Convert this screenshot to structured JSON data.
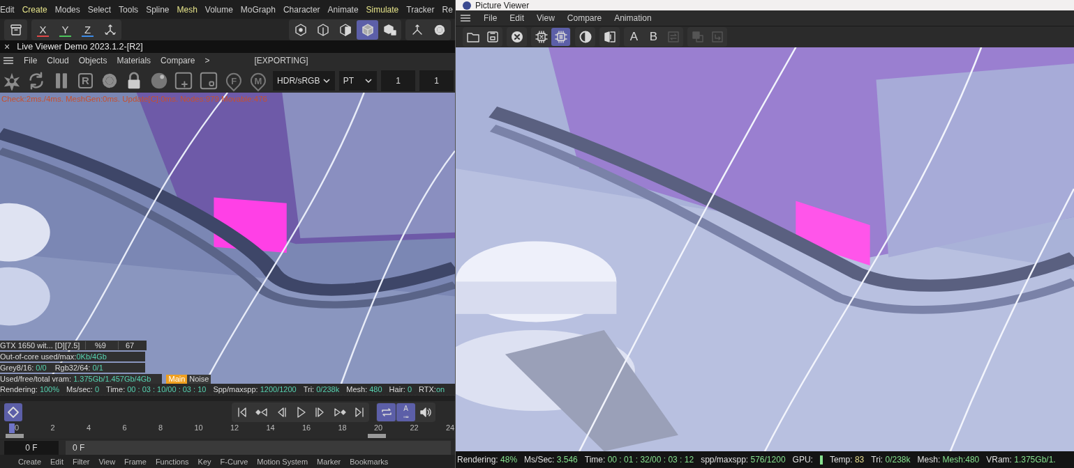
{
  "app_menu": {
    "items": [
      {
        "label": "Edit",
        "highlighted": false
      },
      {
        "label": "Create",
        "highlighted": true
      },
      {
        "label": "Modes",
        "highlighted": false
      },
      {
        "label": "Select",
        "highlighted": false
      },
      {
        "label": "Tools",
        "highlighted": false
      },
      {
        "label": "Spline",
        "highlighted": false
      },
      {
        "label": "Mesh",
        "highlighted": true
      },
      {
        "label": "Volume",
        "highlighted": false
      },
      {
        "label": "MoGraph",
        "highlighted": false
      },
      {
        "label": "Character",
        "highlighted": false
      },
      {
        "label": "Animate",
        "highlighted": false
      },
      {
        "label": "Simulate",
        "highlighted": true
      },
      {
        "label": "Tracker",
        "highlighted": false
      },
      {
        "label": "Re",
        "highlighted": false
      }
    ]
  },
  "main_toolbar": {
    "left_groups": [
      {
        "items": [
          {
            "kind": "archive",
            "selected": false
          }
        ]
      },
      {
        "items": [
          {
            "kind": "letter",
            "label": "X",
            "color": "#e04848",
            "selected": false
          },
          {
            "kind": "letter",
            "label": "Y",
            "color": "#4cc45c",
            "selected": false
          },
          {
            "kind": "letter",
            "label": "Z",
            "color": "#3c8ce8",
            "selected": false
          },
          {
            "kind": "gizmo",
            "selected": false
          }
        ]
      }
    ],
    "right_groups": [
      {
        "items": [
          {
            "kind": "hex-dot",
            "selected": false
          },
          {
            "kind": "hex-edge",
            "selected": false
          },
          {
            "kind": "cube-half",
            "selected": false
          },
          {
            "kind": "cube",
            "selected": true
          },
          {
            "kind": "cubes",
            "selected": false
          }
        ]
      },
      {
        "items": [
          {
            "kind": "axes",
            "selected": false
          },
          {
            "kind": "gear",
            "selected": false
          }
        ]
      }
    ]
  },
  "live_viewer": {
    "title": "Live Viewer Demo 2023.1.2-[R2]",
    "close": "×",
    "menu": [
      {
        "label": "File"
      },
      {
        "label": "Cloud"
      },
      {
        "label": "Objects"
      },
      {
        "label": "Materials"
      },
      {
        "label": "Compare"
      },
      {
        "label": ">"
      }
    ],
    "status_text": "[EXPORTING]",
    "tools": [
      {
        "kind": "aperture"
      },
      {
        "kind": "refresh"
      },
      {
        "kind": "pause"
      },
      {
        "kind": "boxed-letter",
        "label": "R"
      },
      {
        "kind": "gear"
      },
      {
        "kind": "lock"
      },
      {
        "kind": "sphere"
      },
      {
        "kind": "add-region"
      },
      {
        "kind": "region"
      },
      {
        "kind": "pin-letter",
        "label": "F"
      },
      {
        "kind": "pin-letter",
        "label": "M"
      }
    ],
    "dropdowns": [
      {
        "value": "HDR/sRGB"
      },
      {
        "value": "PT"
      }
    ],
    "fields": [
      {
        "value": "1"
      },
      {
        "value": "1"
      }
    ],
    "viewport": {
      "kind": "picture",
      "debug_text": "Check:2ms./4ms. MeshGen:0ms. Update[C]:0ms. Nodes:979 Movable:476",
      "gpu_row": {
        "cells": [
          "GTX 1650 wit... [D][7.5]",
          "%9",
          "67"
        ]
      },
      "stat_rows": [
        {
          "items": [
            {
              "label": "Out-of-core used/max:",
              "value": "0Kb/4Gb"
            }
          ]
        },
        {
          "items": [
            {
              "label": "Grey8/16: ",
              "value": "0/0"
            },
            {
              "label": "Rgb32/64: ",
              "value": "0/1"
            }
          ]
        },
        {
          "items": [
            {
              "label": "Used/free/total vram: ",
              "value": "1.375Gb/1.457Gb/4Gb"
            }
          ]
        }
      ],
      "tabs": [
        {
          "label": "Main",
          "selected": true
        },
        {
          "label": "Noise",
          "selected": false
        }
      ]
    },
    "status_bar": [
      {
        "label": "Rendering: ",
        "value": "100%"
      },
      {
        "label": "Ms/sec: ",
        "value": "0"
      },
      {
        "label": "Time: ",
        "value": "00 : 03 : 10/00 : 03 : 10"
      },
      {
        "label": "Spp/maxspp: ",
        "value": "1200/1200"
      },
      {
        "label": "Tri: ",
        "value": "0/238k"
      },
      {
        "label": "Mesh: ",
        "value": "480"
      },
      {
        "label": "Hair: ",
        "value": "0"
      },
      {
        "label": "RTX:",
        "value": "on"
      }
    ]
  },
  "timeline": {
    "key_button": {
      "kind": "key",
      "selected": true
    },
    "transport": [
      {
        "kind": "first"
      },
      {
        "kind": "prev-key"
      },
      {
        "kind": "prev-frame"
      },
      {
        "kind": "play"
      },
      {
        "kind": "next-frame"
      },
      {
        "kind": "next-key"
      },
      {
        "kind": "last"
      }
    ],
    "toggles": [
      {
        "kind": "loop",
        "selected": true
      },
      {
        "kind": "auto-key",
        "label": "A",
        "selected": true
      },
      {
        "kind": "sound",
        "selected": false
      }
    ],
    "ruler": [
      "0",
      "2",
      "4",
      "6",
      "8",
      "10",
      "12",
      "14",
      "16",
      "18",
      "20",
      "22",
      "24"
    ],
    "playhead": {
      "level": 0
    },
    "frame_field": "0 F",
    "frame_bar": "0 F"
  },
  "bottom_menu": [
    "Create",
    "Edit",
    "Filter",
    "View",
    "Frame",
    "Functions",
    "Key",
    "F-Curve",
    "Motion System",
    "Marker",
    "Bookmarks"
  ],
  "picture_viewer": {
    "title": "Picture Viewer",
    "menu": [
      {
        "label": "File"
      },
      {
        "label": "Edit"
      },
      {
        "label": "View"
      },
      {
        "label": "Compare"
      },
      {
        "label": "Animation"
      }
    ],
    "toolbar": [
      {
        "items": [
          {
            "kind": "folder",
            "selected": false,
            "disabled": false
          },
          {
            "kind": "save",
            "selected": false,
            "disabled": false
          }
        ]
      },
      {
        "items": [
          {
            "kind": "close-circle",
            "selected": false,
            "disabled": false
          }
        ]
      },
      {
        "items": [
          {
            "kind": "chip-x",
            "selected": false,
            "disabled": false
          },
          {
            "kind": "chip",
            "selected": true,
            "disabled": false
          }
        ]
      },
      {
        "items": [
          {
            "kind": "contrast",
            "selected": false,
            "disabled": false
          }
        ]
      },
      {
        "items": [
          {
            "kind": "split",
            "selected": false,
            "disabled": false
          }
        ]
      },
      {
        "items": [
          {
            "kind": "letter",
            "label": "A",
            "selected": false,
            "disabled": false
          },
          {
            "kind": "letter",
            "label": "B",
            "selected": false,
            "disabled": false
          },
          {
            "kind": "swap",
            "selected": false,
            "disabled": true
          }
        ]
      },
      {
        "items": [
          {
            "kind": "layers",
            "selected": false,
            "disabled": true
          },
          {
            "kind": "export",
            "selected": false,
            "disabled": true
          }
        ]
      }
    ],
    "status_bar": [
      {
        "kind": "text",
        "label": "Rendering: ",
        "value": "48%",
        "color": "#86e08e"
      },
      {
        "kind": "text",
        "label": "Ms/Sec: ",
        "value": "3.546",
        "color": "#86e08e"
      },
      {
        "kind": "text",
        "label": "Time: ",
        "value": "00 : 01 : 32/00 : 03 : 12",
        "color": "#86e08e"
      },
      {
        "kind": "text",
        "label": "spp/maxspp: ",
        "value": "576/1200",
        "color": "#86e08e"
      },
      {
        "kind": "meter",
        "label": "GPU: ",
        "color": "#86e08e"
      },
      {
        "kind": "text",
        "label": "Temp: ",
        "value": "83",
        "color": "#e6dc8e"
      },
      {
        "kind": "text",
        "label": "Tri: ",
        "value": "0/238k",
        "color": "#86e08e"
      },
      {
        "kind": "text",
        "label": "Mesh: ",
        "value": "Mesh:480",
        "color": "#86e08e"
      },
      {
        "kind": "text",
        "label": "VRam: ",
        "value": "1.375Gb/1.",
        "color": "#86e08e"
      }
    ]
  }
}
